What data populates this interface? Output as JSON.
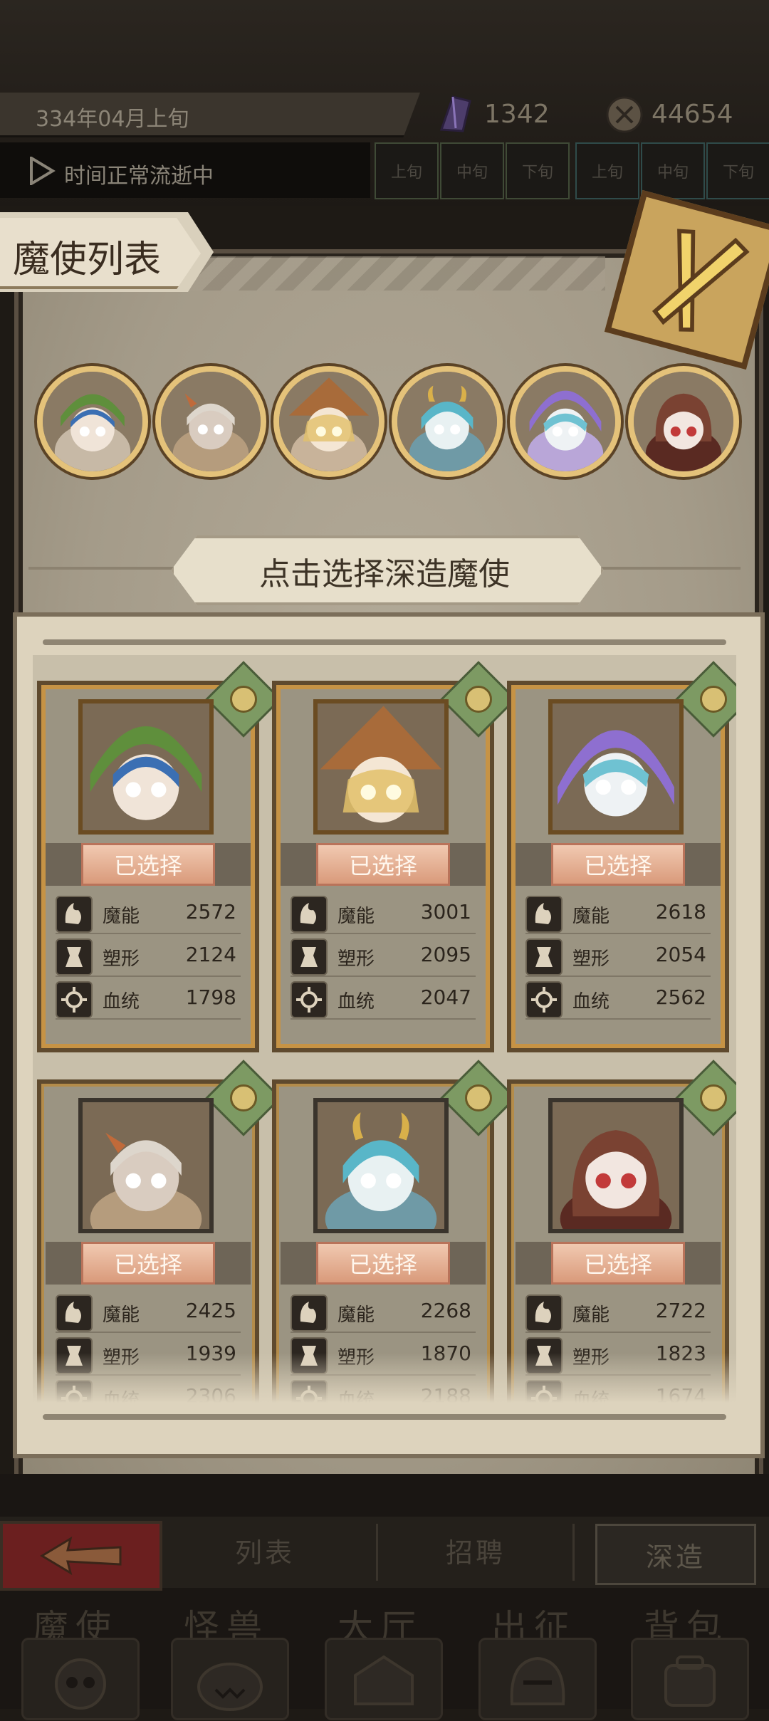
{
  "status_bar": {
    "date": "334年04月上旬",
    "time_status": "时间正常流逝中",
    "crystal_count": "1342",
    "coin_count": "44654",
    "period_labels": [
      "上旬",
      "中旬",
      "下旬"
    ]
  },
  "header": {
    "title": "魔使列表"
  },
  "instruction": "点击选择深造魔使",
  "avatars": [
    {
      "name": "plant-hood-girl",
      "hair": "#3b6fb3",
      "accent": "#5f8f3c"
    },
    {
      "name": "horned-white-hair",
      "hair": "#ddd6cc",
      "accent": "#c06a3a"
    },
    {
      "name": "witch-hat-blonde",
      "hair": "#e2c06a",
      "accent": "#a86b3a"
    },
    {
      "name": "teal-horned-girl",
      "hair": "#59b6c8",
      "accent": "#d9b04a"
    },
    {
      "name": "purple-hood-girl",
      "hair": "#8e6fd0",
      "accent": "#6fc2d2"
    },
    {
      "name": "red-eyed-brunette",
      "hair": "#7a4232",
      "accent": "#c23a3a"
    }
  ],
  "cards": [
    {
      "selected_label": "已选择",
      "stats": [
        {
          "label": "魔能",
          "value": "2572"
        },
        {
          "label": "塑形",
          "value": "2124"
        },
        {
          "label": "血统",
          "value": "1798"
        }
      ],
      "hair": "#3b6fb3",
      "accent": "#5f8f3c"
    },
    {
      "selected_label": "已选择",
      "stats": [
        {
          "label": "魔能",
          "value": "3001"
        },
        {
          "label": "塑形",
          "value": "2095"
        },
        {
          "label": "血统",
          "value": "2047"
        }
      ],
      "hair": "#e2c06a",
      "accent": "#a86b3a"
    },
    {
      "selected_label": "已选择",
      "stats": [
        {
          "label": "魔能",
          "value": "2618"
        },
        {
          "label": "塑形",
          "value": "2054"
        },
        {
          "label": "血统",
          "value": "2562"
        }
      ],
      "hair": "#8e6fd0",
      "accent": "#6fc2d2"
    },
    {
      "selected_label": "已选择",
      "stats": [
        {
          "label": "魔能",
          "value": "2425"
        },
        {
          "label": "塑形",
          "value": "1939"
        },
        {
          "label": "血统",
          "value": "2306"
        }
      ],
      "hair": "#ddd6cc",
      "accent": "#c06a3a"
    },
    {
      "selected_label": "已选择",
      "stats": [
        {
          "label": "魔能",
          "value": "2268"
        },
        {
          "label": "塑形",
          "value": "1870"
        },
        {
          "label": "血统",
          "value": "2188"
        }
      ],
      "hair": "#59b6c8",
      "accent": "#d9b04a"
    },
    {
      "selected_label": "已选择",
      "stats": [
        {
          "label": "魔能",
          "value": "2722"
        },
        {
          "label": "塑形",
          "value": "1823"
        },
        {
          "label": "血统",
          "value": "1674"
        }
      ],
      "hair": "#7a4232",
      "accent": "#c23a3a"
    }
  ],
  "subnav": {
    "list": "列表",
    "recruit": "招聘",
    "advance": "深造"
  },
  "mainnav": {
    "mage": "魔使",
    "monster": "怪兽",
    "hall": "大厅",
    "expedition": "出征",
    "backpack": "背包"
  },
  "colors": {
    "selected_button": "#e3ad92",
    "parchment": "#c8bfaa",
    "frame_gold": "#c69345"
  }
}
